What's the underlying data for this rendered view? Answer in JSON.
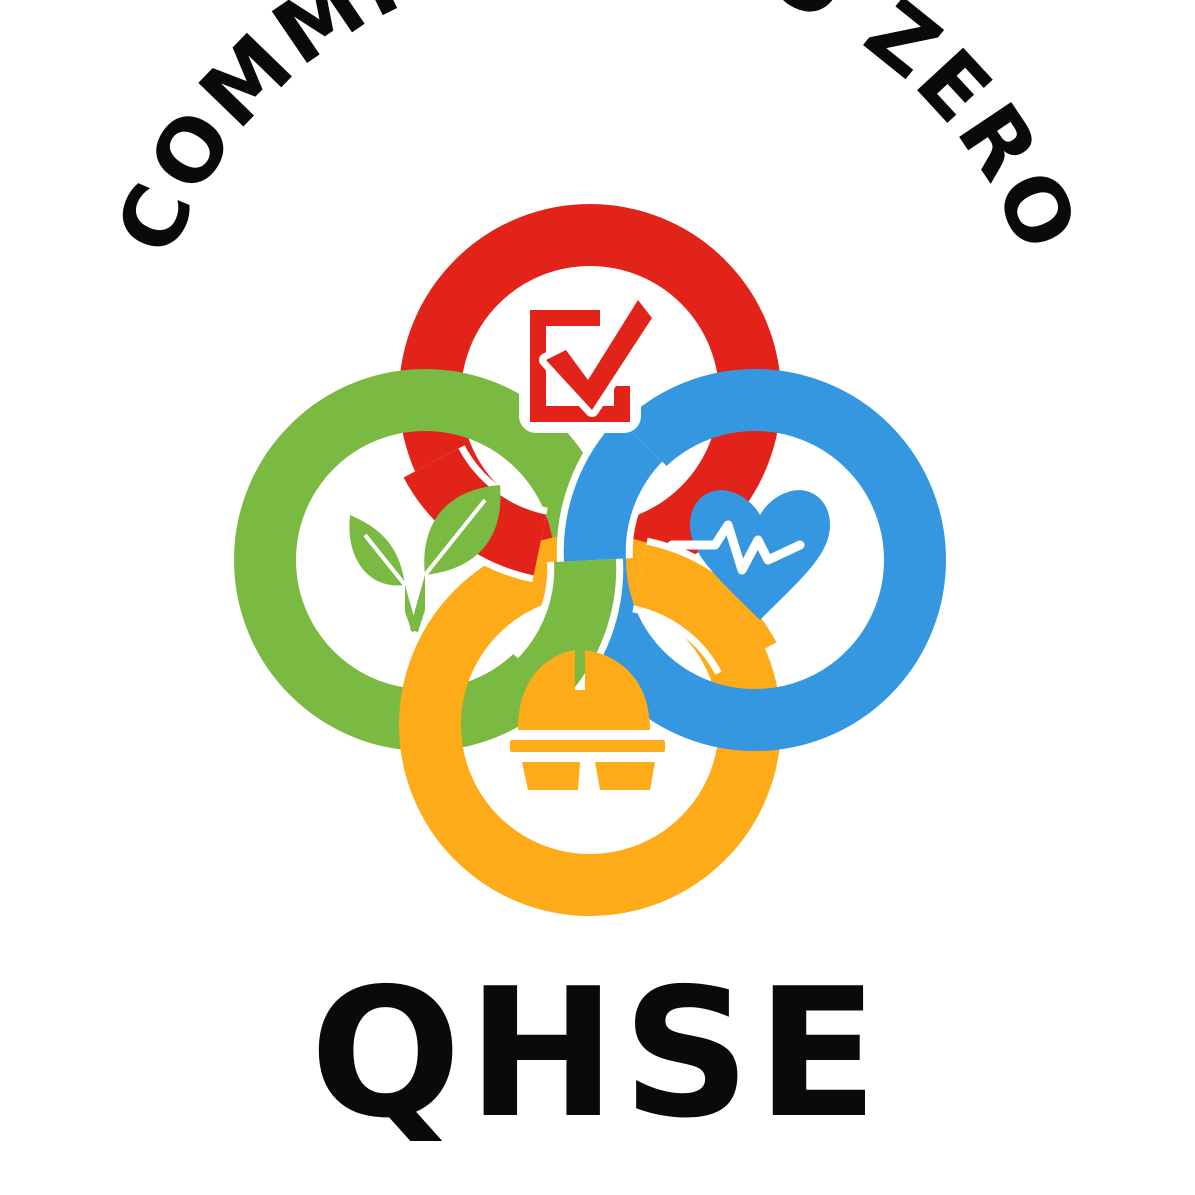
{
  "logo": {
    "tagline": "COMMITTED TO ZERO",
    "brand": "QHSE",
    "colors": {
      "quality_ring": "#e2231a",
      "environment_ring": "#7aba43",
      "health_ring": "#3497e0",
      "safety_ring": "#fdab19",
      "text": "#0a0a0a",
      "background": "#ffffff"
    },
    "icons": [
      "checkbox-check-icon",
      "leaf-sprout-icon",
      "heart-pulse-icon",
      "hard-hat-icon"
    ]
  }
}
